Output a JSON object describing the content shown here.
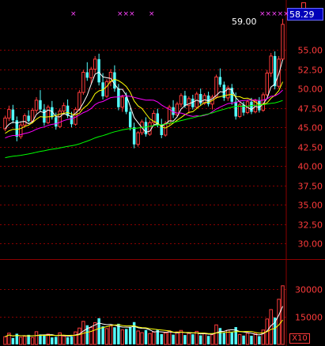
{
  "current_price": "58.29",
  "high_label": "59.00",
  "vol_multiplier": "X10",
  "price_axis": {
    "ticks": [
      "55.00",
      "52.50",
      "50.00",
      "47.50",
      "45.00",
      "42.50",
      "40.00",
      "37.50",
      "35.00",
      "32.50",
      "30.00"
    ]
  },
  "volume_axis": {
    "ticks": [
      "30000",
      "15000"
    ]
  },
  "top_markers": [
    "×",
    "×××",
    "×",
    "×××××"
  ],
  "colors": {
    "background": "#000000",
    "up_candle": "#ff3b3b",
    "down_candle": "#54ffff",
    "grid": "#8b0000",
    "ma5": "#ffffff",
    "ma10": "#ffff00",
    "ma20": "#ff00ff",
    "ma60": "#00ff00",
    "axis_text": "#ff3b3b"
  },
  "chart_data": {
    "type": "candlestick",
    "ylim": [
      28,
      60
    ],
    "ma_lines": [
      "MA5",
      "MA10",
      "MA20",
      "MA60"
    ],
    "candles": [
      [
        44.8,
        46.5,
        44.5,
        46.2
      ],
      [
        46.2,
        47.8,
        45.8,
        47.3
      ],
      [
        47.3,
        47.9,
        45.5,
        45.9
      ],
      [
        45.9,
        46.4,
        43.2,
        43.8
      ],
      [
        43.8,
        45.6,
        43.5,
        45.3
      ],
      [
        45.3,
        46.8,
        45.0,
        46.5
      ],
      [
        46.5,
        47.2,
        45.6,
        45.8
      ],
      [
        45.8,
        47.5,
        45.5,
        47.2
      ],
      [
        47.2,
        48.9,
        46.8,
        48.5
      ],
      [
        48.5,
        49.8,
        47.0,
        47.3
      ],
      [
        47.3,
        48.0,
        45.2,
        45.6
      ],
      [
        45.6,
        47.9,
        45.4,
        47.6
      ],
      [
        47.6,
        48.4,
        46.0,
        46.3
      ],
      [
        46.3,
        46.9,
        44.7,
        45.1
      ],
      [
        45.1,
        47.4,
        44.9,
        47.1
      ],
      [
        47.1,
        48.2,
        46.6,
        47.8
      ],
      [
        47.8,
        48.6,
        46.2,
        46.5
      ],
      [
        46.5,
        47.0,
        45.0,
        45.4
      ],
      [
        45.4,
        47.6,
        45.2,
        47.3
      ],
      [
        47.3,
        49.8,
        47.1,
        49.5
      ],
      [
        49.5,
        52.4,
        49.2,
        52.1
      ],
      [
        52.1,
        53.4,
        51.0,
        51.4
      ],
      [
        51.4,
        52.8,
        50.6,
        52.5
      ],
      [
        52.5,
        54.2,
        52.0,
        53.8
      ],
      [
        53.8,
        54.5,
        50.4,
        50.8
      ],
      [
        50.8,
        52.0,
        48.6,
        49.0
      ],
      [
        49.0,
        51.2,
        48.8,
        50.9
      ],
      [
        50.9,
        52.5,
        50.3,
        52.1
      ],
      [
        52.1,
        53.0,
        49.6,
        50.0
      ],
      [
        50.0,
        50.6,
        47.2,
        47.6
      ],
      [
        47.6,
        49.2,
        47.0,
        48.9
      ],
      [
        48.9,
        49.5,
        46.7,
        47.0
      ],
      [
        47.0,
        47.5,
        44.6,
        45.0
      ],
      [
        45.0,
        45.6,
        42.3,
        42.8
      ],
      [
        42.8,
        44.5,
        42.5,
        44.3
      ],
      [
        44.3,
        46.0,
        44.0,
        45.7
      ],
      [
        45.7,
        46.3,
        43.8,
        44.1
      ],
      [
        44.1,
        45.9,
        43.9,
        45.6
      ],
      [
        45.6,
        47.2,
        45.3,
        46.8
      ],
      [
        46.8,
        47.4,
        45.0,
        45.3
      ],
      [
        45.3,
        46.1,
        43.6,
        44.0
      ],
      [
        44.0,
        45.8,
        43.8,
        45.5
      ],
      [
        45.5,
        47.9,
        45.3,
        47.6
      ],
      [
        47.6,
        48.5,
        46.2,
        46.6
      ],
      [
        46.6,
        48.3,
        46.4,
        48.0
      ],
      [
        48.0,
        49.4,
        47.6,
        49.1
      ],
      [
        49.1,
        49.7,
        47.5,
        47.8
      ],
      [
        47.8,
        49.0,
        46.8,
        48.7
      ],
      [
        48.7,
        49.2,
        47.3,
        47.6
      ],
      [
        47.6,
        49.6,
        47.4,
        49.3
      ],
      [
        49.3,
        50.0,
        47.8,
        48.1
      ],
      [
        48.1,
        49.4,
        47.9,
        49.1
      ],
      [
        49.1,
        49.6,
        47.7,
        48.0
      ],
      [
        48.0,
        49.2,
        47.3,
        48.9
      ],
      [
        48.9,
        51.8,
        48.7,
        51.5
      ],
      [
        51.5,
        52.6,
        50.2,
        50.5
      ],
      [
        50.5,
        50.9,
        48.4,
        48.8
      ],
      [
        48.8,
        50.4,
        48.4,
        50.1
      ],
      [
        50.1,
        50.6,
        47.9,
        48.3
      ],
      [
        48.3,
        49.5,
        46.0,
        46.4
      ],
      [
        46.4,
        48.2,
        46.2,
        47.9
      ],
      [
        47.9,
        48.3,
        46.5,
        46.9
      ],
      [
        46.9,
        48.6,
        46.7,
        48.3
      ],
      [
        48.3,
        48.8,
        46.7,
        47.0
      ],
      [
        47.0,
        48.7,
        46.8,
        48.4
      ],
      [
        48.4,
        48.9,
        46.9,
        47.2
      ],
      [
        47.2,
        49.5,
        47.0,
        49.2
      ],
      [
        49.2,
        52.4,
        49.0,
        52.0
      ],
      [
        52.0,
        54.6,
        51.5,
        54.2
      ],
      [
        54.2,
        54.8,
        49.9,
        50.3
      ],
      [
        50.3,
        54.2,
        50.0,
        53.8
      ],
      [
        53.8,
        59.0,
        53.6,
        58.29
      ]
    ],
    "volume": [
      4200,
      6100,
      3500,
      5800,
      3900,
      4400,
      5200,
      3700,
      6900,
      5400,
      4800,
      5600,
      3800,
      4100,
      6300,
      4500,
      3900,
      4200,
      6800,
      8900,
      12500,
      10400,
      9200,
      11800,
      14200,
      9800,
      8600,
      10100,
      9300,
      11200,
      7900,
      8400,
      9600,
      12100,
      7300,
      6400,
      7800,
      5900,
      6700,
      8100,
      5600,
      6200,
      7400,
      5300,
      6800,
      7600,
      5100,
      6000,
      5500,
      7100,
      4900,
      5800,
      4600,
      5300,
      10600,
      8900,
      6200,
      7700,
      6500,
      9400,
      5400,
      4800,
      6100,
      4700,
      5900,
      4500,
      7800,
      13800,
      18900,
      14600,
      24500,
      31800
    ]
  }
}
